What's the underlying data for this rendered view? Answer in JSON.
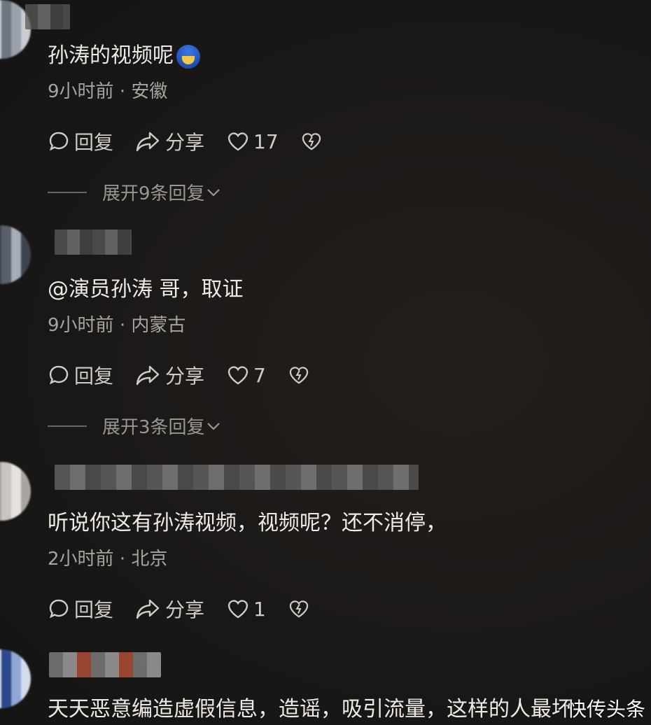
{
  "comments": [
    {
      "text": "孙涛的视频呢",
      "time": "9小时前",
      "location": "安徽",
      "reply_label": "回复",
      "share_label": "分享",
      "likes": "17",
      "expand_label": "展开9条回复"
    },
    {
      "text": "@演员孙涛 哥，取证",
      "time": "9小时前",
      "location": "内蒙古",
      "reply_label": "回复",
      "share_label": "分享",
      "likes": "7",
      "expand_label": "展开3条回复"
    },
    {
      "text": "听说你这有孙涛视频，视频呢？还不消停，",
      "time": "2小时前",
      "location": "北京",
      "reply_label": "回复",
      "share_label": "分享",
      "likes": "1"
    },
    {
      "text": "天天恶意编造虚假信息，造谣，吸引流量，这样的人最坏"
    }
  ],
  "separator": "·",
  "watermark": "快传头条",
  "colors": {
    "background": "#1c1a19",
    "text": "#eeeae6",
    "meta": "#a8a4a0",
    "action": "#cfcbc7"
  },
  "icons": {
    "reply": "comment-bubble-icon",
    "share": "share-arrow-icon",
    "like": "heart-icon",
    "dislike": "broken-heart-icon",
    "expand": "chevron-down-icon"
  }
}
